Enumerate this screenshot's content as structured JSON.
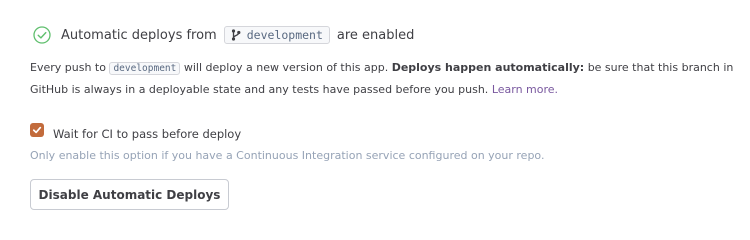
{
  "status": {
    "icon": "check-circle-icon",
    "prefix": "Automatic deploys from",
    "branch_icon": "git-branch-icon",
    "branch": "development",
    "suffix": "are enabled",
    "success_color": "#5fbf6d"
  },
  "description": {
    "line1_before": "Every push to",
    "branch_chip": "development",
    "line1_middle": "will deploy a new version of this app.",
    "line1_bold": "Deploys happen automatically:",
    "line1_after": "be sure that this branch in",
    "line2": "GitHub is always in a deployable state and any tests have passed before you push.",
    "learn_more": "Learn more.",
    "link_color": "#79589f"
  },
  "ci_option": {
    "checked": true,
    "label": "Wait for CI to pass before deploy",
    "help": "Only enable this option if you have a Continuous Integration service configured on your repo.",
    "checkbox_color": "#c26b3c"
  },
  "actions": {
    "disable_label": "Disable Automatic Deploys"
  }
}
